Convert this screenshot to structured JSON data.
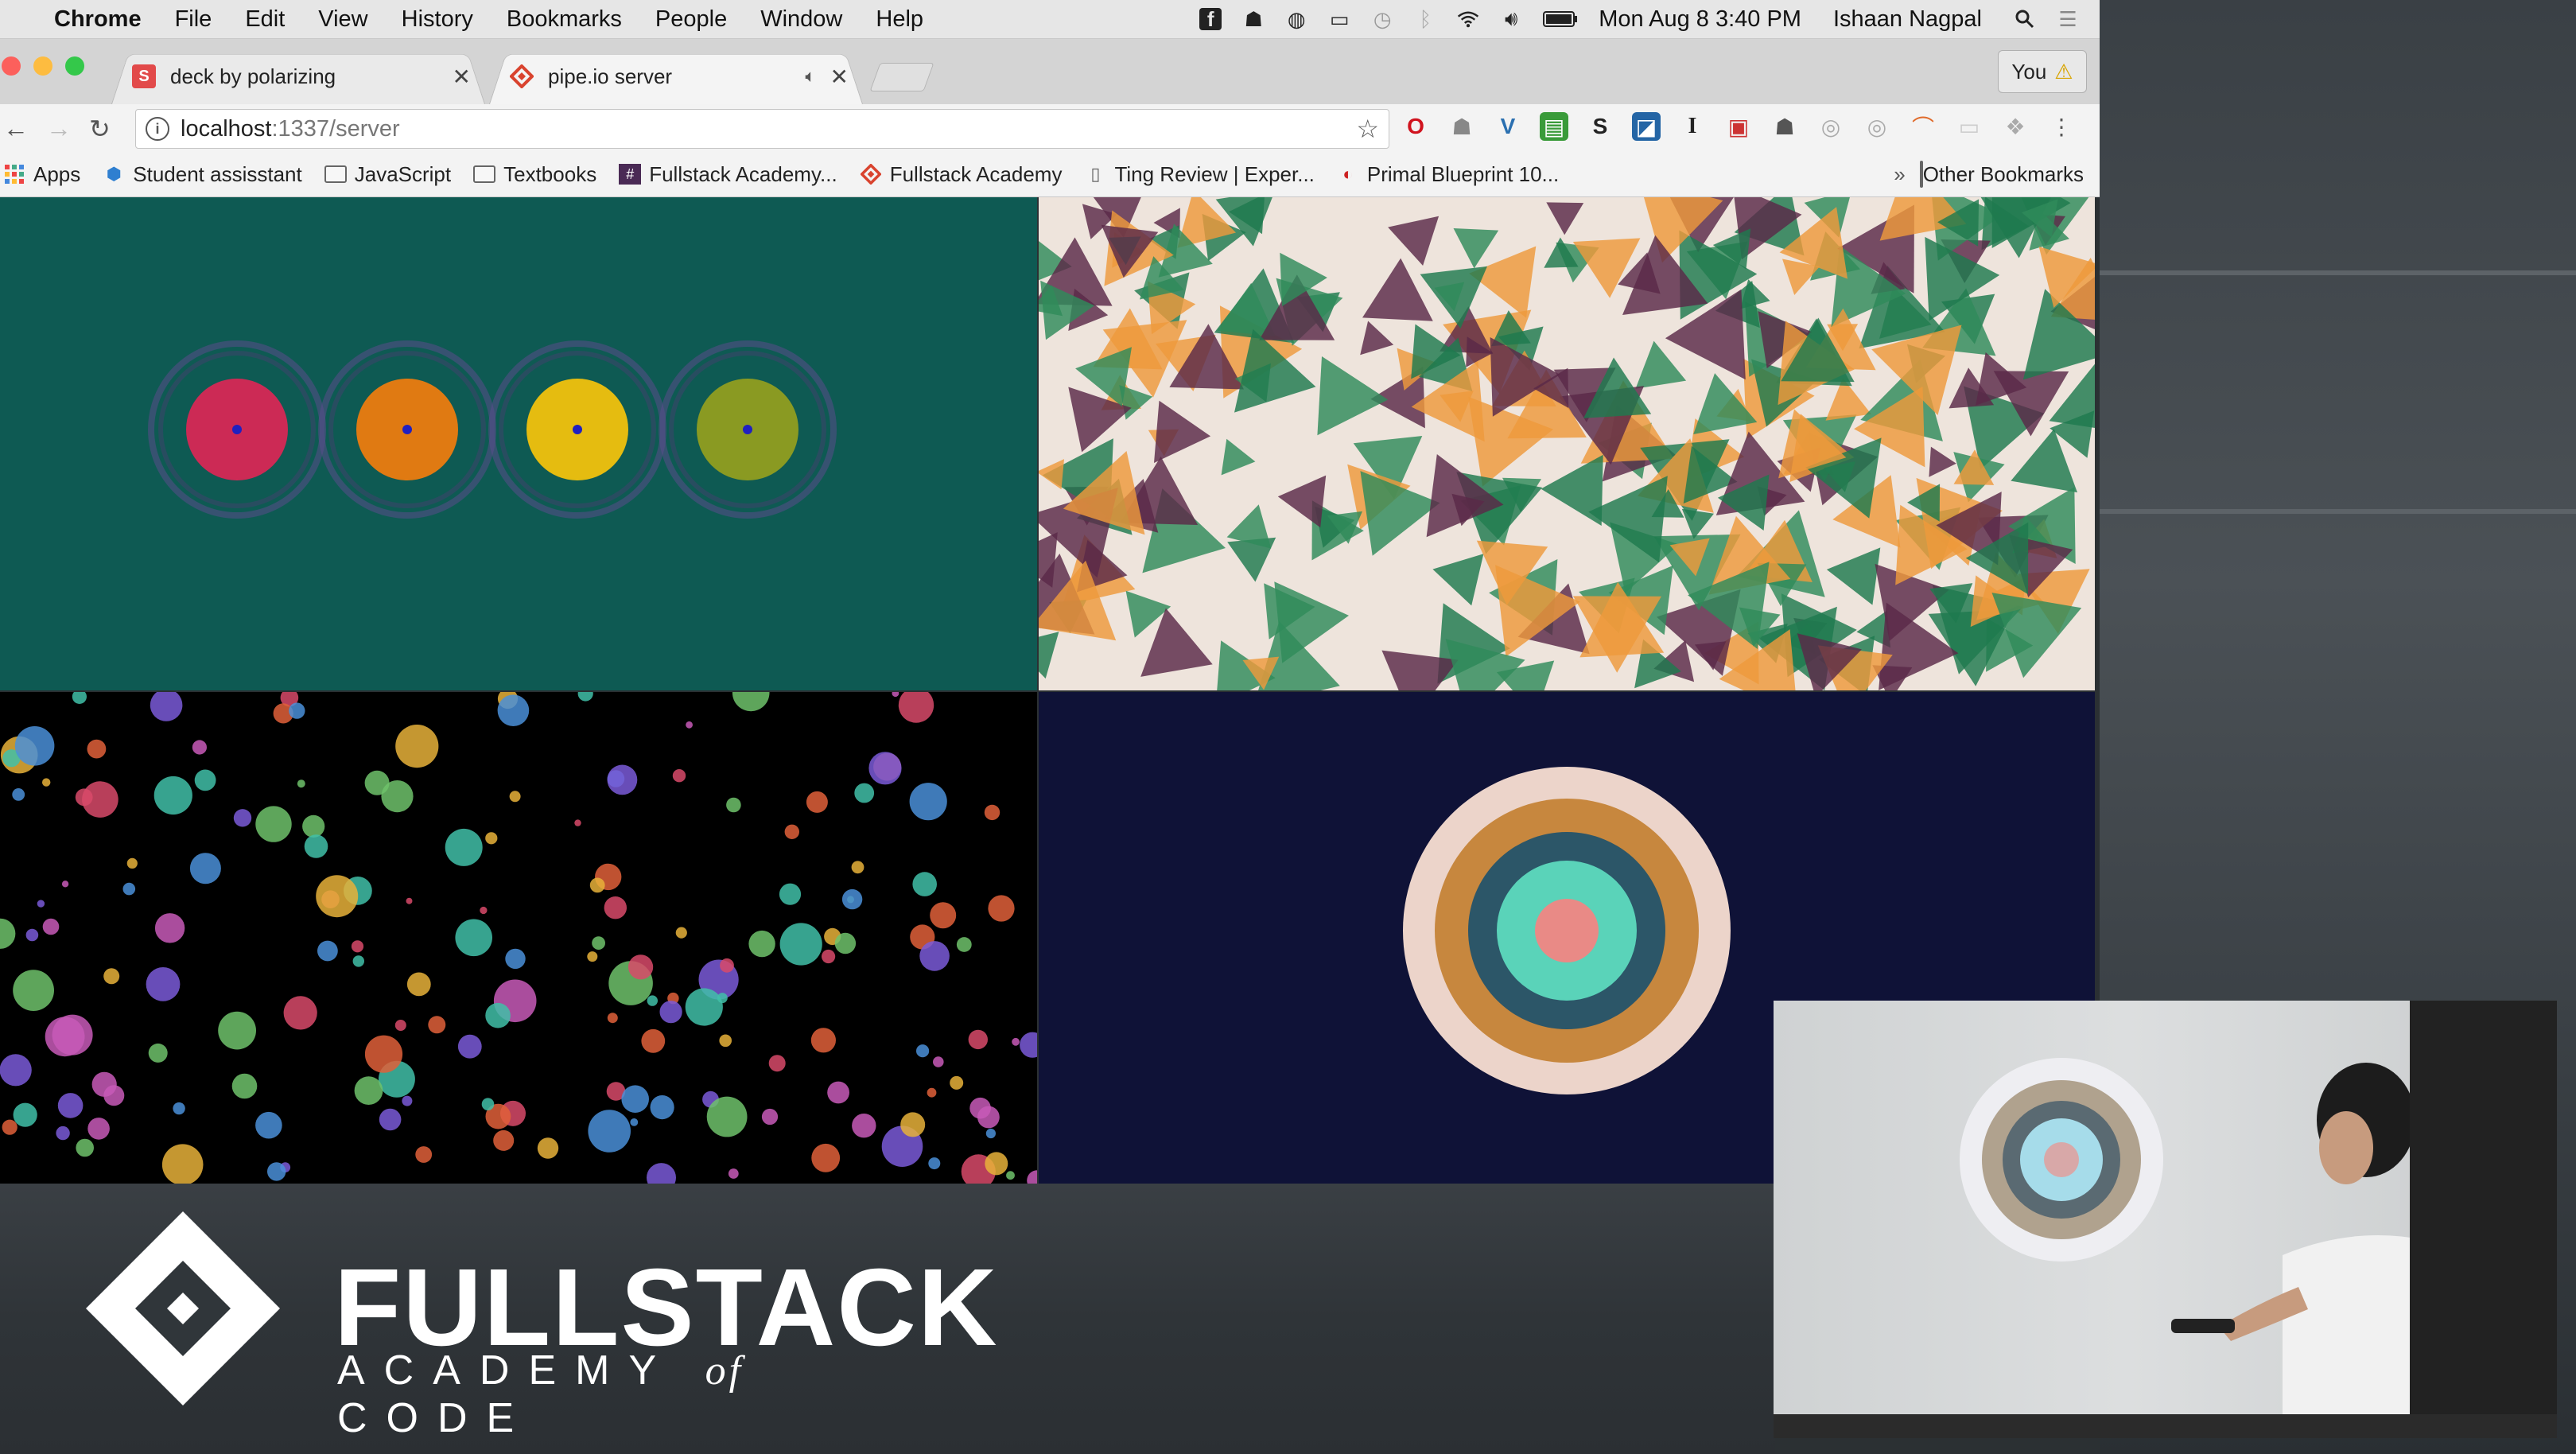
{
  "menubar": {
    "app": "Chrome",
    "menus": [
      "File",
      "Edit",
      "View",
      "History",
      "Bookmarks",
      "People",
      "Window",
      "Help"
    ],
    "datetime": "Mon Aug 8  3:40 PM",
    "user": "Ishaan Nagpal"
  },
  "tabs": [
    {
      "title": "deck by polarizing",
      "favicon_letter": "S"
    },
    {
      "title": "pipe.io server"
    }
  ],
  "profile": {
    "label": "You"
  },
  "address": {
    "host": "localhost",
    "path": ":1337/server"
  },
  "bookmarks": [
    {
      "label": "Apps",
      "icon": "apps-grid-icon"
    },
    {
      "label": "Student assisstant",
      "icon": "cube-icon"
    },
    {
      "label": "JavaScript",
      "icon": "folder-icon"
    },
    {
      "label": "Textbooks",
      "icon": "folder-icon"
    },
    {
      "label": "Fullstack Academy...",
      "icon": "fullstack-hash-icon"
    },
    {
      "label": "Fullstack Academy",
      "icon": "fullstack-diamond-icon"
    },
    {
      "label": "Ting Review | Exper...",
      "icon": "page-icon"
    },
    {
      "label": "Primal Blueprint 10...",
      "icon": "primal-icon"
    }
  ],
  "other_bookmarks": "Other Bookmarks",
  "brand": {
    "word": "FULLSTACK",
    "sub_left": "ACADEMY",
    "sub_of": "of",
    "sub_right": "CODE"
  },
  "colors": {
    "teal_bg": "#0e5a53",
    "cream_bg": "#eee4dc",
    "navy_bg": "#0f1237",
    "dot_colors": [
      "#cc2a55",
      "#e07a12",
      "#e5bc10",
      "#8a9a22"
    ],
    "target_rings": [
      "#ecd4ca",
      "#c7873e",
      "#2c5668",
      "#5ad3b9",
      "#e98a86"
    ]
  }
}
